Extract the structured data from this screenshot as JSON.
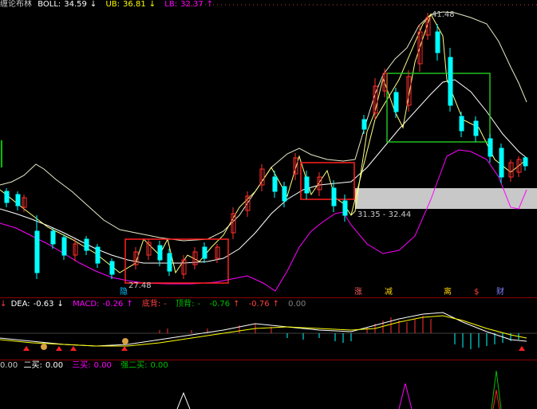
{
  "top_indicator": {
    "name": "缠论布林",
    "boll_label": "BOLL:",
    "boll_value": "34.59",
    "ub_label": "UB:",
    "ub_value": "36.81",
    "lb_label": "LB:",
    "lb_value": "32.37",
    "colors": {
      "boll": "#ffffff",
      "ub": "#ffff00",
      "lb": "#ff00ff"
    }
  },
  "price_annotations": {
    "high": "41.48",
    "low": "27.48",
    "range": "31.35 - 32.44"
  },
  "signal_tags": [
    {
      "text": "涨",
      "color": "#ff6060"
    },
    {
      "text": "减",
      "color": "#ffd000"
    },
    {
      "text": "离",
      "color": "#ffd000"
    },
    {
      "text": "$",
      "color": "#ff4040"
    },
    {
      "text": "财",
      "color": "#8080ff"
    },
    {
      "text": "隐",
      "color": "#00c0ff"
    }
  ],
  "macd_indicator": {
    "dea_label": "DEA:",
    "dea_value": "-0.63",
    "macd_label": "MACD:",
    "macd_value": "-0.26",
    "bottom_div_label": "底背:",
    "bottom_div_value": "-",
    "top_div_label": "顶背:",
    "top_div_value": "-",
    "v1": "-0.76",
    "v2": "-0.76",
    "v3": "0.00"
  },
  "buy_indicator": {
    "first_value": "0.00",
    "second_buy_label": "二买:",
    "second_buy_value": "0.00",
    "third_buy_label": "三买:",
    "third_buy_value": "0.00",
    "strong_second_label": "强二买:",
    "strong_second_value": "0.00"
  },
  "arrow_glyph": "↑",
  "down_arrow_glyph": "↓",
  "coin_glyph": "$"
}
